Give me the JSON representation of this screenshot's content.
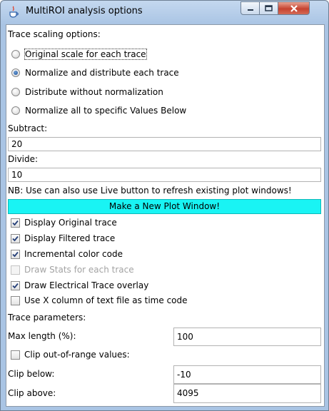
{
  "window": {
    "title": "MultiROI analysis options"
  },
  "scaling": {
    "heading": "Trace scaling options:",
    "options": [
      {
        "label": "Original scale for each trace",
        "selected": false
      },
      {
        "label": "Normalize and distribute each trace",
        "selected": true
      },
      {
        "label": "Distribute without normalization",
        "selected": false
      },
      {
        "label": "Normalize all to specific Values Below",
        "selected": false
      }
    ]
  },
  "subtract": {
    "label": "Subtract:",
    "value": "20"
  },
  "divide": {
    "label": "Divide:",
    "value": "10"
  },
  "note": "NB: Use can also use Live button to refresh existing plot windows!",
  "new_plot_button": "Make a New Plot Window!",
  "checks": [
    {
      "label": "Display Original trace",
      "checked": true,
      "enabled": true
    },
    {
      "label": "Display Filtered trace",
      "checked": true,
      "enabled": true
    },
    {
      "label": "Incremental color code",
      "checked": true,
      "enabled": true
    },
    {
      "label": "Draw Stats for each trace",
      "checked": false,
      "enabled": false
    },
    {
      "label": "Draw Electrical Trace overlay",
      "checked": true,
      "enabled": true
    },
    {
      "label": "Use X column of text file as time code",
      "checked": false,
      "enabled": true
    }
  ],
  "params": {
    "heading": "Trace parameters:",
    "max_length": {
      "label": "Max length (%):",
      "value": "100"
    },
    "clip_out_of_range": {
      "label": "Clip out-of-range values:",
      "checked": false
    },
    "clip_below": {
      "label": "Clip below:",
      "value": "-10"
    },
    "clip_above": {
      "label": "Clip above:",
      "value": "4095"
    }
  },
  "colors": {
    "accent_button": "#19f4f4",
    "titlebar": "#b9d1ea",
    "close_button": "#c6422f"
  }
}
